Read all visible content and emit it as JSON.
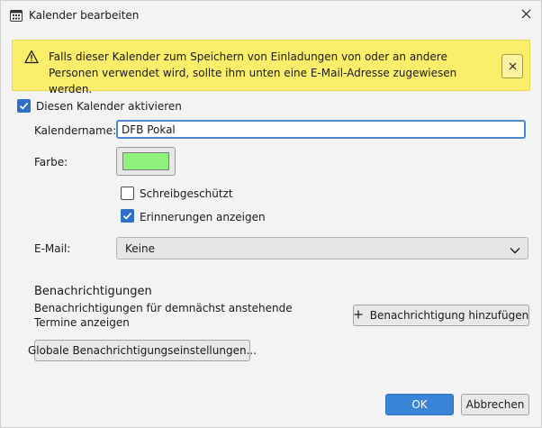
{
  "window": {
    "title": "Kalender bearbeiten",
    "title_icon": "calendar-icon",
    "close_icon": "close-icon"
  },
  "banner": {
    "icon": "warning-icon",
    "text": "Falls dieser Kalender zum Speichern von Einladungen von oder an andere Personen verwendet wird, sollte ihm unten eine E-Mail-Adresse zugewiesen werden.",
    "close_icon": "close-icon",
    "background": "#fbee6a"
  },
  "form": {
    "enable_label": "Diesen Kalender aktivieren",
    "enable_checked": true,
    "name_label": "Kalendername:",
    "name_value": "DFB Pokal",
    "color_label": "Farbe:",
    "color_value": "#8ff27c",
    "readonly_label": "Schreibgeschützt",
    "readonly_checked": false,
    "reminders_label": "Erinnerungen anzeigen",
    "reminders_checked": true,
    "email_label": "E-Mail:",
    "email_value": "Keine"
  },
  "notifications": {
    "title": "Benachrichtigungen",
    "description": "Benachrichtigungen für demnächst anstehende Termine anzeigen",
    "add_button": "Benachrichtigung hinzufügen",
    "add_icon": "plus-icon",
    "global_button": "Globale Benachrichtigungseinstellungen..."
  },
  "footer": {
    "ok_label": "OK",
    "cancel_label": "Abbrechen",
    "accent": "#3a84d8"
  }
}
